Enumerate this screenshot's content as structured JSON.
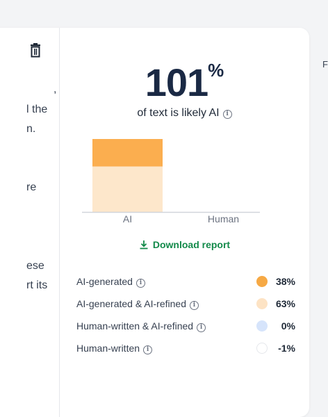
{
  "left_pane": {
    "lines": [
      ",",
      "l the",
      "n.",
      "re",
      "ese",
      "rt its"
    ]
  },
  "detector": {
    "percentage": "101",
    "percent_sign": "%",
    "subtitle": "of text is likely AI",
    "download_label": "Download report"
  },
  "chart_data": {
    "type": "bar",
    "categories": [
      "AI",
      "Human"
    ],
    "series": [
      {
        "values": [
          63,
          0
        ],
        "color": "#fde7cb"
      },
      {
        "values": [
          38,
          0
        ],
        "color": "#fbae4f"
      }
    ],
    "stacked": true,
    "ylim": [
      0,
      101
    ],
    "axis_color": "#d1d5db"
  },
  "legend": [
    {
      "label": "AI-generated",
      "value": "38%",
      "color": "#f6a945",
      "border": "#f6a945"
    },
    {
      "label": "AI-generated & AI-refined",
      "value": "63%",
      "color": "#fde3c4",
      "border": "#fde3c4"
    },
    {
      "label": "Human-written & AI-refined",
      "value": "0%",
      "color": "#d6e4fb",
      "border": "#d6e4fb"
    },
    {
      "label": "Human-written",
      "value": "-1%",
      "color": "#ffffff",
      "border": "#e5e7eb"
    }
  ],
  "edge_text": "F"
}
